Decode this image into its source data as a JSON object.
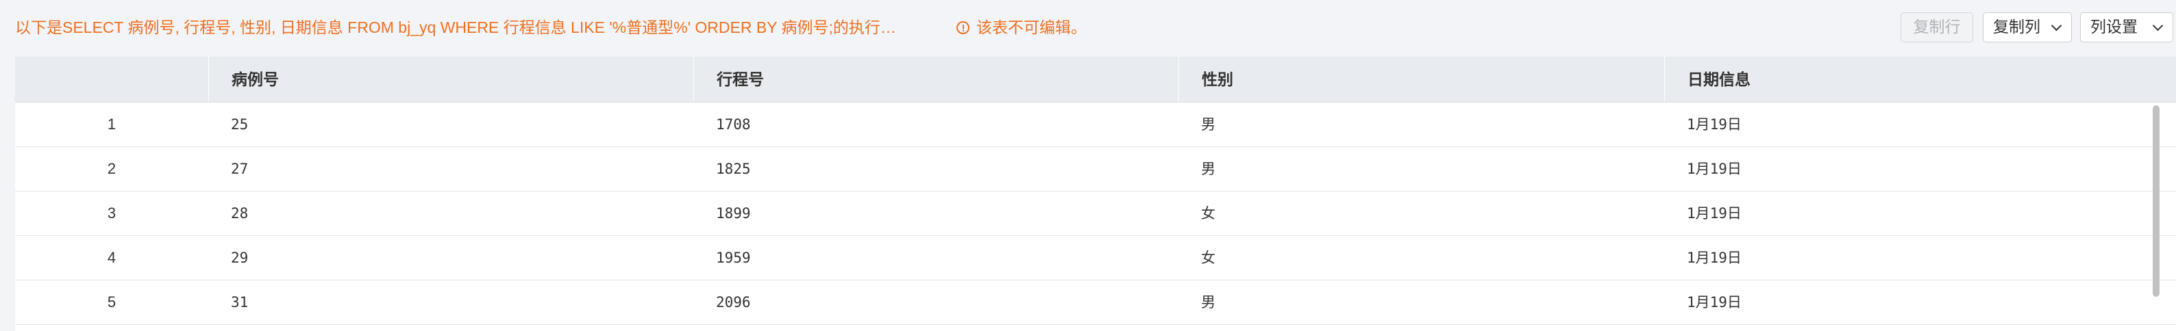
{
  "toolbar": {
    "sql_info": "以下是SELECT 病例号, 行程号, 性别, 日期信息 FROM bj_yq WHERE 行程信息 LIKE '%普通型%' ORDER BY 病例号;的执行…",
    "readonly_notice": "该表不可编辑。",
    "copy_row_label": "复制行",
    "copy_col_label": "复制列",
    "col_settings_label": "列设置",
    "warning_color": "#f07020"
  },
  "table": {
    "columns": [
      "",
      "病例号",
      "行程号",
      "性别",
      "日期信息"
    ],
    "rows": [
      {
        "index": "1",
        "case_no": "25",
        "trip_no": "1708",
        "gender": "男",
        "date": "1月19日"
      },
      {
        "index": "2",
        "case_no": "27",
        "trip_no": "1825",
        "gender": "男",
        "date": "1月19日"
      },
      {
        "index": "3",
        "case_no": "28",
        "trip_no": "1899",
        "gender": "女",
        "date": "1月19日"
      },
      {
        "index": "4",
        "case_no": "29",
        "trip_no": "1959",
        "gender": "女",
        "date": "1月19日"
      },
      {
        "index": "5",
        "case_no": "31",
        "trip_no": "2096",
        "gender": "男",
        "date": "1月19日"
      }
    ]
  }
}
